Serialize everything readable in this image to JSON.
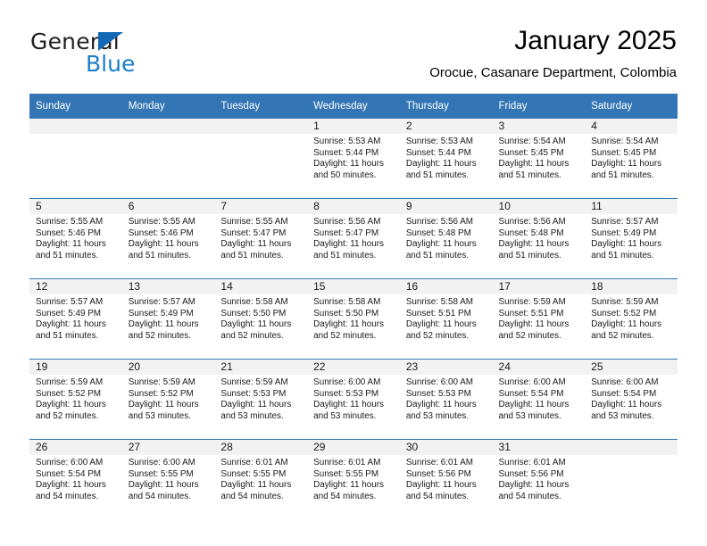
{
  "brand": {
    "name_part1": "General",
    "name_part2": "Blue",
    "triangle_color": "#1268b3",
    "blue_color": "#1a7ec8"
  },
  "header": {
    "title": "January 2025",
    "subtitle": "Orocue, Casanare Department, Colombia"
  },
  "theme": {
    "header_blue": "#3476b5",
    "day_band_gray": "#f2f2f2",
    "text_color": "#1a1a1a"
  },
  "weekday_headers": [
    "Sunday",
    "Monday",
    "Tuesday",
    "Wednesday",
    "Thursday",
    "Friday",
    "Saturday"
  ],
  "weeks": [
    [
      {
        "day": "",
        "sunrise": "",
        "sunset": "",
        "daylight": ""
      },
      {
        "day": "",
        "sunrise": "",
        "sunset": "",
        "daylight": ""
      },
      {
        "day": "",
        "sunrise": "",
        "sunset": "",
        "daylight": ""
      },
      {
        "day": "1",
        "sunrise": "Sunrise: 5:53 AM",
        "sunset": "Sunset: 5:44 PM",
        "daylight": "Daylight: 11 hours and 50 minutes."
      },
      {
        "day": "2",
        "sunrise": "Sunrise: 5:53 AM",
        "sunset": "Sunset: 5:44 PM",
        "daylight": "Daylight: 11 hours and 51 minutes."
      },
      {
        "day": "3",
        "sunrise": "Sunrise: 5:54 AM",
        "sunset": "Sunset: 5:45 PM",
        "daylight": "Daylight: 11 hours and 51 minutes."
      },
      {
        "day": "4",
        "sunrise": "Sunrise: 5:54 AM",
        "sunset": "Sunset: 5:45 PM",
        "daylight": "Daylight: 11 hours and 51 minutes."
      }
    ],
    [
      {
        "day": "5",
        "sunrise": "Sunrise: 5:55 AM",
        "sunset": "Sunset: 5:46 PM",
        "daylight": "Daylight: 11 hours and 51 minutes."
      },
      {
        "day": "6",
        "sunrise": "Sunrise: 5:55 AM",
        "sunset": "Sunset: 5:46 PM",
        "daylight": "Daylight: 11 hours and 51 minutes."
      },
      {
        "day": "7",
        "sunrise": "Sunrise: 5:55 AM",
        "sunset": "Sunset: 5:47 PM",
        "daylight": "Daylight: 11 hours and 51 minutes."
      },
      {
        "day": "8",
        "sunrise": "Sunrise: 5:56 AM",
        "sunset": "Sunset: 5:47 PM",
        "daylight": "Daylight: 11 hours and 51 minutes."
      },
      {
        "day": "9",
        "sunrise": "Sunrise: 5:56 AM",
        "sunset": "Sunset: 5:48 PM",
        "daylight": "Daylight: 11 hours and 51 minutes."
      },
      {
        "day": "10",
        "sunrise": "Sunrise: 5:56 AM",
        "sunset": "Sunset: 5:48 PM",
        "daylight": "Daylight: 11 hours and 51 minutes."
      },
      {
        "day": "11",
        "sunrise": "Sunrise: 5:57 AM",
        "sunset": "Sunset: 5:49 PM",
        "daylight": "Daylight: 11 hours and 51 minutes."
      }
    ],
    [
      {
        "day": "12",
        "sunrise": "Sunrise: 5:57 AM",
        "sunset": "Sunset: 5:49 PM",
        "daylight": "Daylight: 11 hours and 51 minutes."
      },
      {
        "day": "13",
        "sunrise": "Sunrise: 5:57 AM",
        "sunset": "Sunset: 5:49 PM",
        "daylight": "Daylight: 11 hours and 52 minutes."
      },
      {
        "day": "14",
        "sunrise": "Sunrise: 5:58 AM",
        "sunset": "Sunset: 5:50 PM",
        "daylight": "Daylight: 11 hours and 52 minutes."
      },
      {
        "day": "15",
        "sunrise": "Sunrise: 5:58 AM",
        "sunset": "Sunset: 5:50 PM",
        "daylight": "Daylight: 11 hours and 52 minutes."
      },
      {
        "day": "16",
        "sunrise": "Sunrise: 5:58 AM",
        "sunset": "Sunset: 5:51 PM",
        "daylight": "Daylight: 11 hours and 52 minutes."
      },
      {
        "day": "17",
        "sunrise": "Sunrise: 5:59 AM",
        "sunset": "Sunset: 5:51 PM",
        "daylight": "Daylight: 11 hours and 52 minutes."
      },
      {
        "day": "18",
        "sunrise": "Sunrise: 5:59 AM",
        "sunset": "Sunset: 5:52 PM",
        "daylight": "Daylight: 11 hours and 52 minutes."
      }
    ],
    [
      {
        "day": "19",
        "sunrise": "Sunrise: 5:59 AM",
        "sunset": "Sunset: 5:52 PM",
        "daylight": "Daylight: 11 hours and 52 minutes."
      },
      {
        "day": "20",
        "sunrise": "Sunrise: 5:59 AM",
        "sunset": "Sunset: 5:52 PM",
        "daylight": "Daylight: 11 hours and 53 minutes."
      },
      {
        "day": "21",
        "sunrise": "Sunrise: 5:59 AM",
        "sunset": "Sunset: 5:53 PM",
        "daylight": "Daylight: 11 hours and 53 minutes."
      },
      {
        "day": "22",
        "sunrise": "Sunrise: 6:00 AM",
        "sunset": "Sunset: 5:53 PM",
        "daylight": "Daylight: 11 hours and 53 minutes."
      },
      {
        "day": "23",
        "sunrise": "Sunrise: 6:00 AM",
        "sunset": "Sunset: 5:53 PM",
        "daylight": "Daylight: 11 hours and 53 minutes."
      },
      {
        "day": "24",
        "sunrise": "Sunrise: 6:00 AM",
        "sunset": "Sunset: 5:54 PM",
        "daylight": "Daylight: 11 hours and 53 minutes."
      },
      {
        "day": "25",
        "sunrise": "Sunrise: 6:00 AM",
        "sunset": "Sunset: 5:54 PM",
        "daylight": "Daylight: 11 hours and 53 minutes."
      }
    ],
    [
      {
        "day": "26",
        "sunrise": "Sunrise: 6:00 AM",
        "sunset": "Sunset: 5:54 PM",
        "daylight": "Daylight: 11 hours and 54 minutes."
      },
      {
        "day": "27",
        "sunrise": "Sunrise: 6:00 AM",
        "sunset": "Sunset: 5:55 PM",
        "daylight": "Daylight: 11 hours and 54 minutes."
      },
      {
        "day": "28",
        "sunrise": "Sunrise: 6:01 AM",
        "sunset": "Sunset: 5:55 PM",
        "daylight": "Daylight: 11 hours and 54 minutes."
      },
      {
        "day": "29",
        "sunrise": "Sunrise: 6:01 AM",
        "sunset": "Sunset: 5:55 PM",
        "daylight": "Daylight: 11 hours and 54 minutes."
      },
      {
        "day": "30",
        "sunrise": "Sunrise: 6:01 AM",
        "sunset": "Sunset: 5:56 PM",
        "daylight": "Daylight: 11 hours and 54 minutes."
      },
      {
        "day": "31",
        "sunrise": "Sunrise: 6:01 AM",
        "sunset": "Sunset: 5:56 PM",
        "daylight": "Daylight: 11 hours and 54 minutes."
      },
      {
        "day": "",
        "sunrise": "",
        "sunset": "",
        "daylight": ""
      }
    ]
  ]
}
